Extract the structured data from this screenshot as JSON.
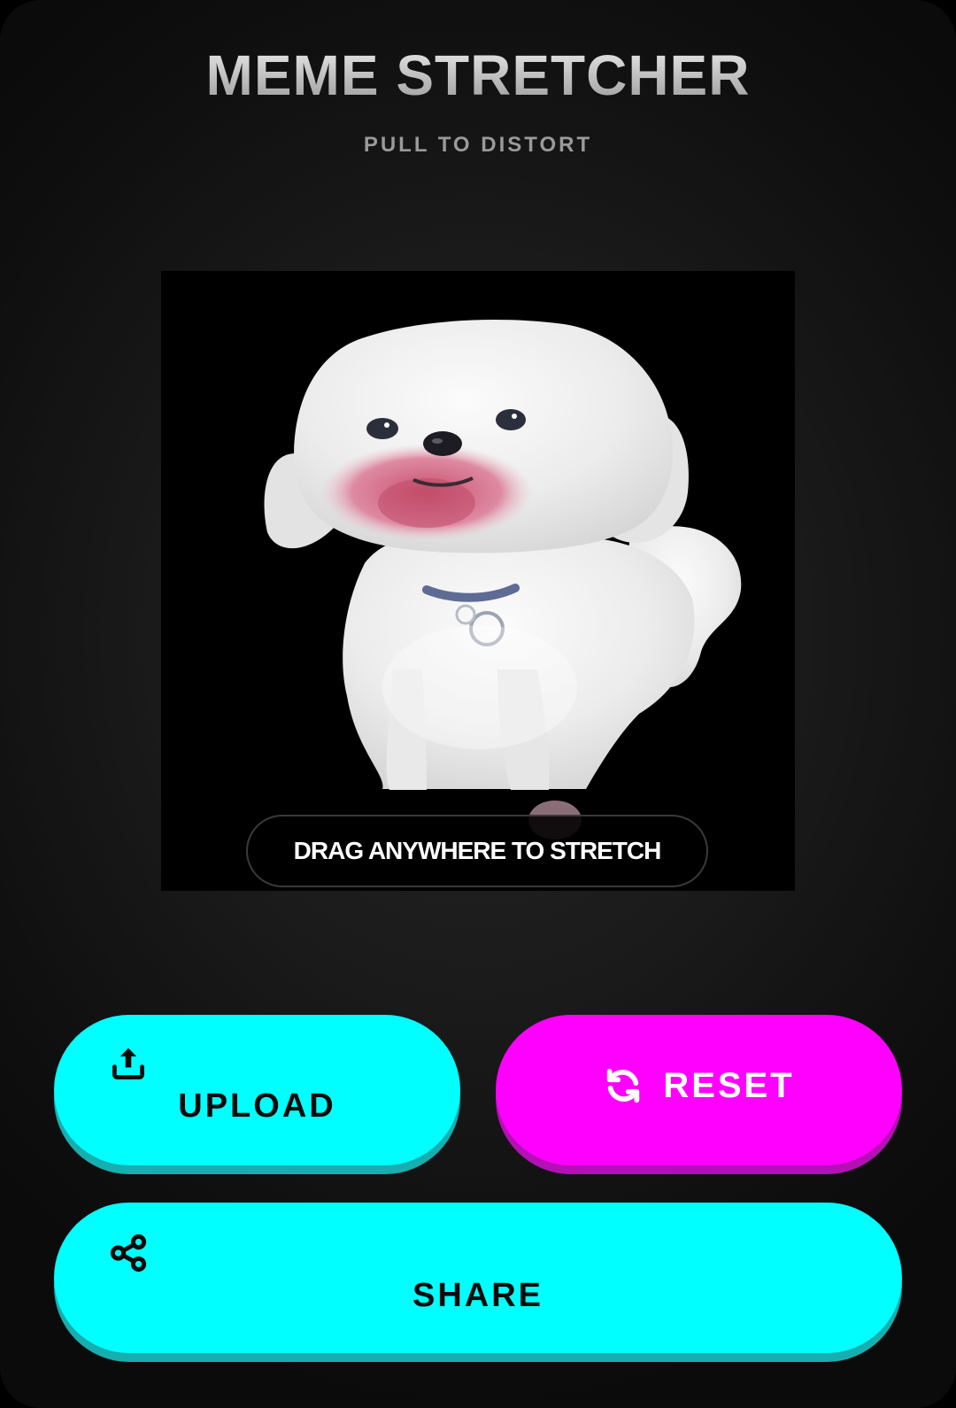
{
  "header": {
    "title": "MEME STRETCHER",
    "subtitle": "PULL TO DISTORT"
  },
  "canvas": {
    "image_subject": "white fluffy dog",
    "hint": "DRAG ANYWHERE TO STRETCH"
  },
  "buttons": {
    "upload": {
      "label": "UPLOAD",
      "icon": "upload-icon",
      "color": "#00ffff"
    },
    "reset": {
      "label": "RESET",
      "icon": "refresh-icon",
      "color": "#ff00ff"
    },
    "share": {
      "label": "SHARE",
      "icon": "share-icon",
      "color": "#00ffff"
    }
  }
}
